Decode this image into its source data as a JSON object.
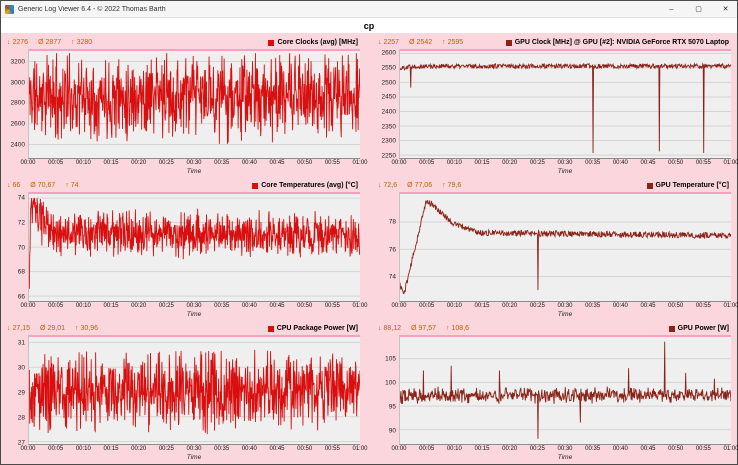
{
  "window": {
    "title": "Generic Log Viewer 6.4  -  © 2022 Thomas Barth",
    "controls": {
      "minimize": "–",
      "maximize": "▢",
      "close": "✕"
    }
  },
  "header": {
    "dataset_label": "cp"
  },
  "symbols": {
    "min": "↓",
    "avg": "Ø",
    "max": "↑"
  },
  "axis": {
    "time_ticks": [
      "00:00",
      "00:05",
      "00:10",
      "00:15",
      "00:20",
      "00:25",
      "00:30",
      "00:35",
      "00:40",
      "00:45",
      "00:50",
      "00:55",
      "01:00"
    ],
    "time_label": "Time"
  },
  "colors": {
    "window_bg": "#fbd7dd",
    "plot_bg": "#f0efef",
    "grid_line": "#d6d3d3",
    "stats_text": "#c05f00",
    "cpu_series": "#d90f0f",
    "gpu_series": "#8a2318",
    "highlight_stripe": "#f99fc0"
  },
  "chart_data": [
    {
      "id": "core-clocks",
      "type": "line",
      "title": "Core Clocks (avg) [MHz]",
      "color": "#d90f0f",
      "stats": {
        "min": "2276",
        "avg": "2877",
        "max": "3280"
      },
      "ylim": [
        2270,
        3320
      ],
      "yticks": [
        2400,
        2600,
        2800,
        3000,
        3200
      ],
      "gen": {
        "seed": 11,
        "samples": 900,
        "dist": "tri",
        "noise": 470,
        "clamp": [
          2276,
          3280
        ],
        "keypoints": [
          [
            0,
            2865
          ],
          [
            1,
            2865
          ]
        ]
      }
    },
    {
      "id": "gpu-clock",
      "type": "line",
      "title": "GPU Clock [MHz] @ GPU [#2]: NVIDIA GeForce RTX 5070 Laptop",
      "color": "#8a2318",
      "stats": {
        "min": "2257",
        "avg": "2542",
        "max": "2595"
      },
      "ylim": [
        2240,
        2615
      ],
      "yticks": [
        2250,
        2300,
        2350,
        2400,
        2450,
        2500,
        2550,
        2600
      ],
      "gen": {
        "seed": 22,
        "samples": 680,
        "dist": "uniform",
        "noise": 8,
        "clamp": [
          2257,
          2595
        ],
        "keypoints": [
          [
            0,
            2548
          ],
          [
            0.03,
            2556
          ],
          [
            1,
            2556
          ]
        ],
        "spikes": [
          [
            0.032,
            2482
          ],
          [
            0.583,
            2257
          ],
          [
            0.783,
            2263
          ],
          [
            0.917,
            2257
          ]
        ]
      }
    },
    {
      "id": "core-temps",
      "type": "line",
      "title": "Core Temperatures (avg) [°C]",
      "color": "#d90f0f",
      "stats": {
        "min": "66",
        "avg": "70,67",
        "max": "74"
      },
      "ylim": [
        65.6,
        74.5
      ],
      "yticks": [
        66,
        68,
        70,
        72,
        74
      ],
      "gen": {
        "seed": 33,
        "samples": 900,
        "dist": "tri",
        "noise": 2.1,
        "clamp": [
          66,
          74
        ],
        "keypoints": [
          [
            0,
            66
          ],
          [
            0.006,
            73.5
          ],
          [
            0.03,
            72.3
          ],
          [
            0.08,
            71.1
          ],
          [
            1,
            71.0
          ]
        ]
      }
    },
    {
      "id": "gpu-temp",
      "type": "line",
      "title": "GPU Temperature [°C]",
      "color": "#8a2318",
      "stats": {
        "min": "72,6",
        "avg": "77,06",
        "max": "79,6"
      },
      "ylim": [
        72.2,
        80.2
      ],
      "yticks": [
        74,
        76,
        78
      ],
      "gen": {
        "seed": 44,
        "samples": 680,
        "dist": "uniform",
        "noise": 0.22,
        "clamp": [
          72.6,
          79.6
        ],
        "keypoints": [
          [
            0,
            73.4
          ],
          [
            0.012,
            72.7
          ],
          [
            0.08,
            79.6
          ],
          [
            0.11,
            79.0
          ],
          [
            0.16,
            77.9
          ],
          [
            0.24,
            77.2
          ],
          [
            1,
            77.0
          ]
        ],
        "spikes": [
          [
            0.417,
            73.0
          ]
        ]
      }
    },
    {
      "id": "cpu-package-power",
      "type": "line",
      "title": "CPU Package Power [W]",
      "color": "#d90f0f",
      "stats": {
        "min": "27,15",
        "avg": "29,01",
        "max": "30,96"
      },
      "ylim": [
        26.9,
        31.3
      ],
      "yticks": [
        27,
        28,
        29,
        30,
        31
      ],
      "gen": {
        "seed": 55,
        "samples": 900,
        "dist": "tri",
        "noise": 1.85,
        "clamp": [
          27.15,
          30.96
        ],
        "keypoints": [
          [
            0,
            29.05
          ],
          [
            1,
            29.05
          ]
        ]
      }
    },
    {
      "id": "gpu-power",
      "type": "line",
      "title": "GPU Power [W]",
      "color": "#8a2318",
      "stats": {
        "min": "88,12",
        "avg": "97,57",
        "max": "108,6"
      },
      "ylim": [
        87,
        110
      ],
      "yticks": [
        90,
        95,
        100,
        105
      ],
      "gen": {
        "seed": 66,
        "samples": 680,
        "dist": "tri",
        "noise": 1.9,
        "clamp": [
          88.12,
          108.6
        ],
        "keypoints": [
          [
            0,
            97.3
          ],
          [
            1,
            97.3
          ]
        ],
        "spikes": [
          [
            0.07,
            102.5
          ],
          [
            0.155,
            103.5
          ],
          [
            0.3,
            102.5
          ],
          [
            0.417,
            88.12
          ],
          [
            0.545,
            91.5
          ],
          [
            0.69,
            103
          ],
          [
            0.8,
            108.6
          ],
          [
            0.863,
            102
          ],
          [
            0.95,
            100.8
          ]
        ]
      }
    }
  ]
}
